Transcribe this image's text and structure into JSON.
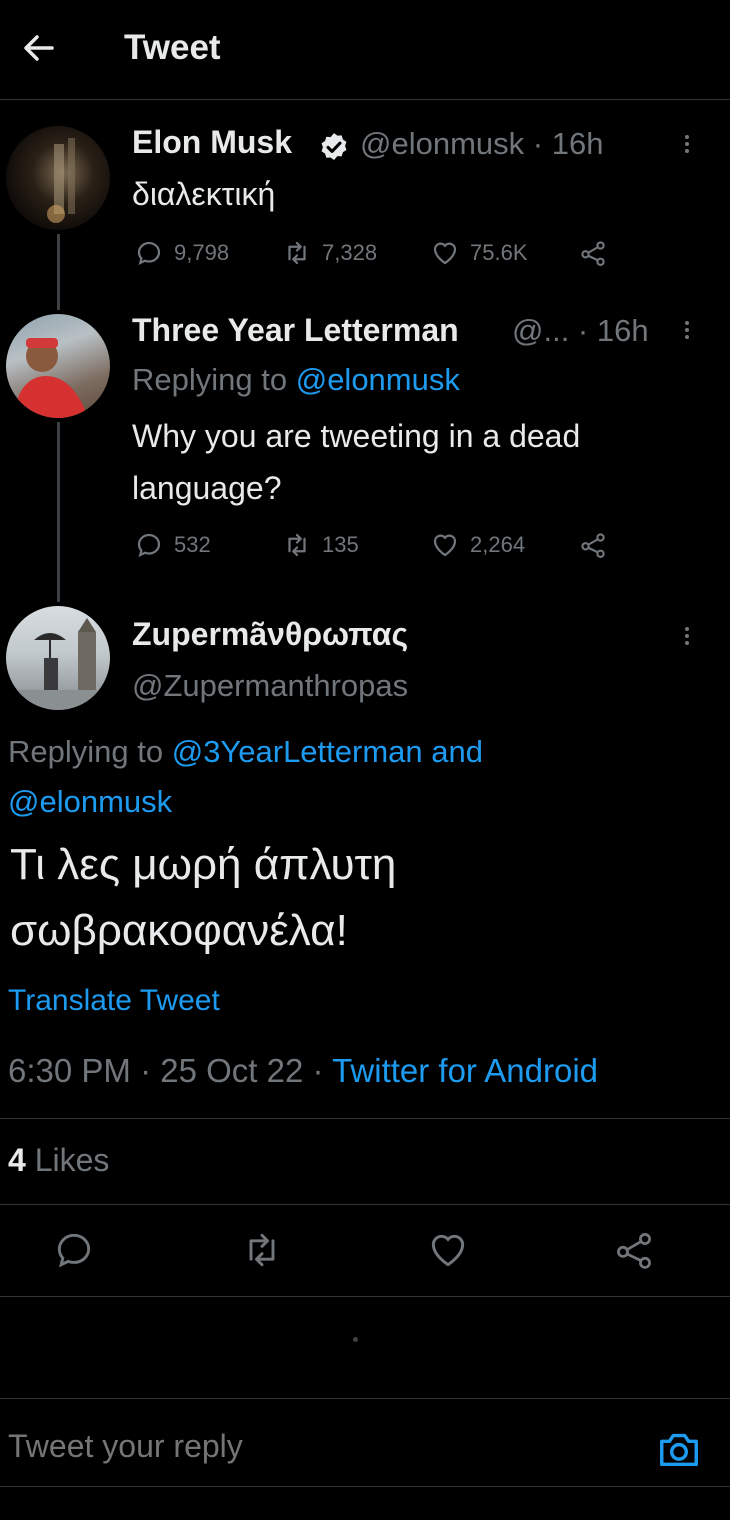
{
  "header": {
    "title": "Tweet"
  },
  "tweets": [
    {
      "name": "Elon Musk",
      "handle": "@elonmusk",
      "time": "16h",
      "text": "διαλεκτική",
      "replies": "9,798",
      "retweets": "7,328",
      "likes": "75.6K"
    },
    {
      "name": "Three Year Letterman",
      "handle": "@...",
      "time": "16h",
      "replying_prefix": "Replying to",
      "replying_to": "@elonmusk",
      "text_line1": "Why you are tweeting in a dead",
      "text_line2": "language?",
      "replies": "532",
      "retweets": "135",
      "likes": "2,264"
    }
  ],
  "main_tweet": {
    "name": "Zupermãνθρωπας",
    "handle": "@Zupermanthropas",
    "replying_prefix": "Replying to",
    "replying_to_line1": "@3YearLetterman and",
    "replying_to_line2": "@elonmusk",
    "text_line1": "Τι λες μωρή άπλυτη",
    "text_line2": "σωβρακοφανέλα!",
    "translate": "Translate Tweet",
    "time": "6:30 PM",
    "date": "25 Oct 22",
    "source": "Twitter for Android",
    "likes_count": "4",
    "likes_label": "Likes"
  },
  "reply_box": {
    "placeholder": "Tweet your reply"
  },
  "colors": {
    "accent": "#1d9bf0",
    "muted": "#71767b",
    "background": "#000000"
  }
}
